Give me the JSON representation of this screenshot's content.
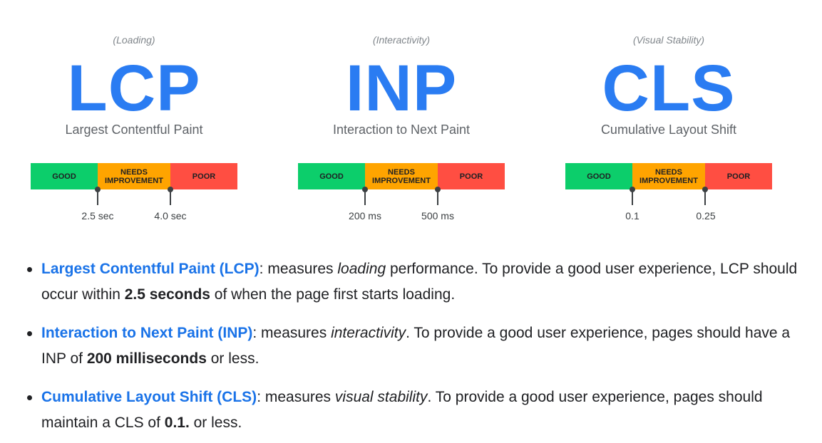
{
  "metrics": [
    {
      "category": "(Loading)",
      "abbr": "LCP",
      "full_name": "Largest Contentful Paint",
      "segments": {
        "good": "GOOD",
        "needs_improvement": "NEEDS IMPROVEMENT",
        "poor": "POOR"
      },
      "thresholds": [
        "2.5 sec",
        "4.0 sec"
      ]
    },
    {
      "category": "(Interactivity)",
      "abbr": "INP",
      "full_name": "Interaction to Next Paint",
      "segments": {
        "good": "GOOD",
        "needs_improvement": "NEEDS IMPROVEMENT",
        "poor": "POOR"
      },
      "thresholds": [
        "200 ms",
        "500 ms"
      ]
    },
    {
      "category": "(Visual Stability)",
      "abbr": "CLS",
      "full_name": "Cumulative Layout Shift",
      "segments": {
        "good": "GOOD",
        "needs_improvement": "NEEDS IMPROVEMENT",
        "poor": "POOR"
      },
      "thresholds": [
        "0.1",
        "0.25"
      ]
    }
  ],
  "colors": {
    "accent": "#1a73e8",
    "good": "#0cce6b",
    "needs_improvement": "#ffa400",
    "poor": "#ff4e42"
  },
  "bullets": [
    {
      "link": "Largest Contentful Paint (LCP)",
      "pre": ": measures ",
      "em": "loading",
      "mid": " performance. To provide a good user experience, LCP should occur within ",
      "strong": "2.5 seconds",
      "post": " of when the page first starts loading."
    },
    {
      "link": "Interaction to Next Paint (INP)",
      "pre": ": measures ",
      "em": "interactivity",
      "mid": ". To provide a good user experience, pages should have a INP of ",
      "strong": "200 milliseconds",
      "post": " or less."
    },
    {
      "link": "Cumulative Layout Shift (CLS)",
      "pre": ": measures ",
      "em": "visual stability",
      "mid": ". To provide a good user experience, pages should maintain a CLS of ",
      "strong": "0.1.",
      "post": " or less."
    }
  ]
}
